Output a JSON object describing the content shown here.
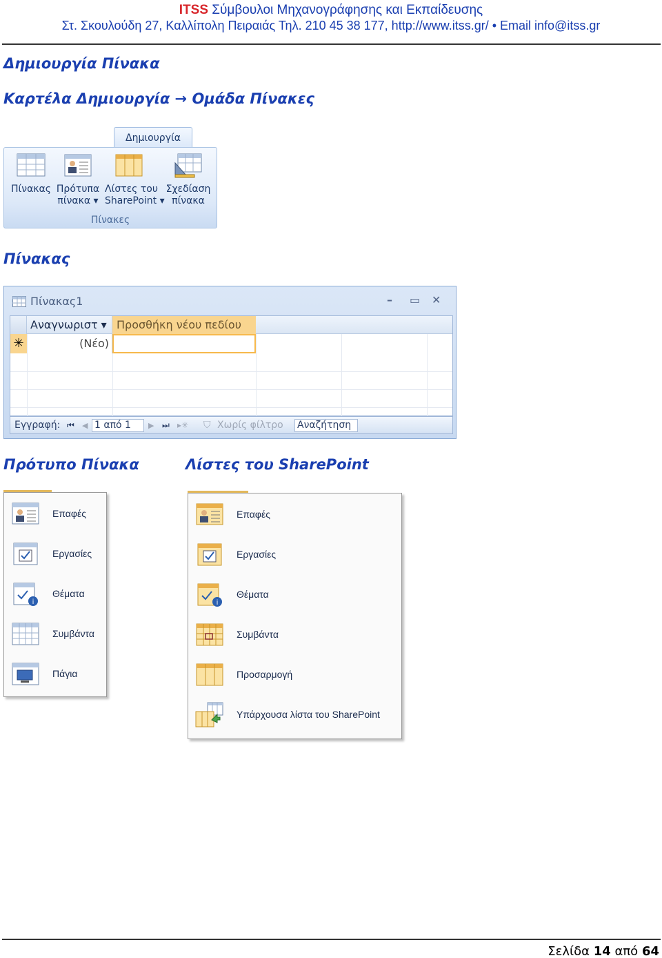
{
  "header": {
    "brand": "ITSS",
    "brand_tail": " Σύμβουλοι Μηχανογράφησης και Εκπαίδευσης",
    "address": "Στ. Σκουλούδη 27, Καλλίπολη Πειραιάς Τηλ. 210 45 38 177, http://www.itss.gr/ •  Email info@itss.gr"
  },
  "sections": {
    "create_table": "Δημιουργία Πίνακα",
    "tab_path": "Καρτέλα Δημιουργία → Ομάδα Πίνακες",
    "table": "Πίνακας",
    "templates": "Πρότυπο Πίνακα",
    "sharepoint": "Λίστες του SharePoint"
  },
  "ribbon": {
    "tab": "Δημιουργία",
    "group": "Πίνακες",
    "buttons": [
      {
        "line1": "Πίνακας",
        "line2": "",
        "icon": "table-icon"
      },
      {
        "line1": "Πρότυπα",
        "line2": "πίνακα ▾",
        "icon": "contact-card-icon"
      },
      {
        "line1": "Λίστες του",
        "line2": "SharePoint ▾",
        "icon": "sharepoint-list-icon"
      },
      {
        "line1": "Σχεδίαση",
        "line2": "πίνακα",
        "icon": "table-design-icon"
      }
    ]
  },
  "table_window": {
    "title": "Πίνακας1",
    "controls": [
      "–",
      "▭",
      "✕"
    ],
    "col1": "Αναγνωριστ ▾",
    "col2": "Προσθήκη νέου πεδίου",
    "new_marker": "✳",
    "new_value": "(Νέο)",
    "nav": {
      "record_label": "Εγγραφή:",
      "position": "1 από 1",
      "filter": "Χωρίς φίλτρο",
      "search": "Αναζήτηση"
    }
  },
  "template_menu": [
    {
      "label": "Επαφές",
      "icon": "contacts-icon"
    },
    {
      "label": "Εργασίες",
      "icon": "tasks-icon"
    },
    {
      "label": "Θέματα",
      "icon": "issues-icon"
    },
    {
      "label": "Συμβάντα",
      "icon": "events-icon"
    },
    {
      "label": "Πάγια",
      "icon": "assets-icon"
    }
  ],
  "sharepoint_menu": [
    {
      "label": "Επαφές",
      "icon": "contacts-icon"
    },
    {
      "label": "Εργασίες",
      "icon": "tasks-icon"
    },
    {
      "label": "Θέματα",
      "icon": "issues-icon"
    },
    {
      "label": "Συμβάντα",
      "icon": "events-icon"
    },
    {
      "label": "Προσαρμογή",
      "icon": "custom-list-icon"
    },
    {
      "label": "Υπάρχουσα λίστα του SharePoint",
      "icon": "existing-list-icon"
    }
  ],
  "footer": {
    "page_word": "Σελίδα",
    "page": "14",
    "of_word": "από",
    "total": "64"
  }
}
